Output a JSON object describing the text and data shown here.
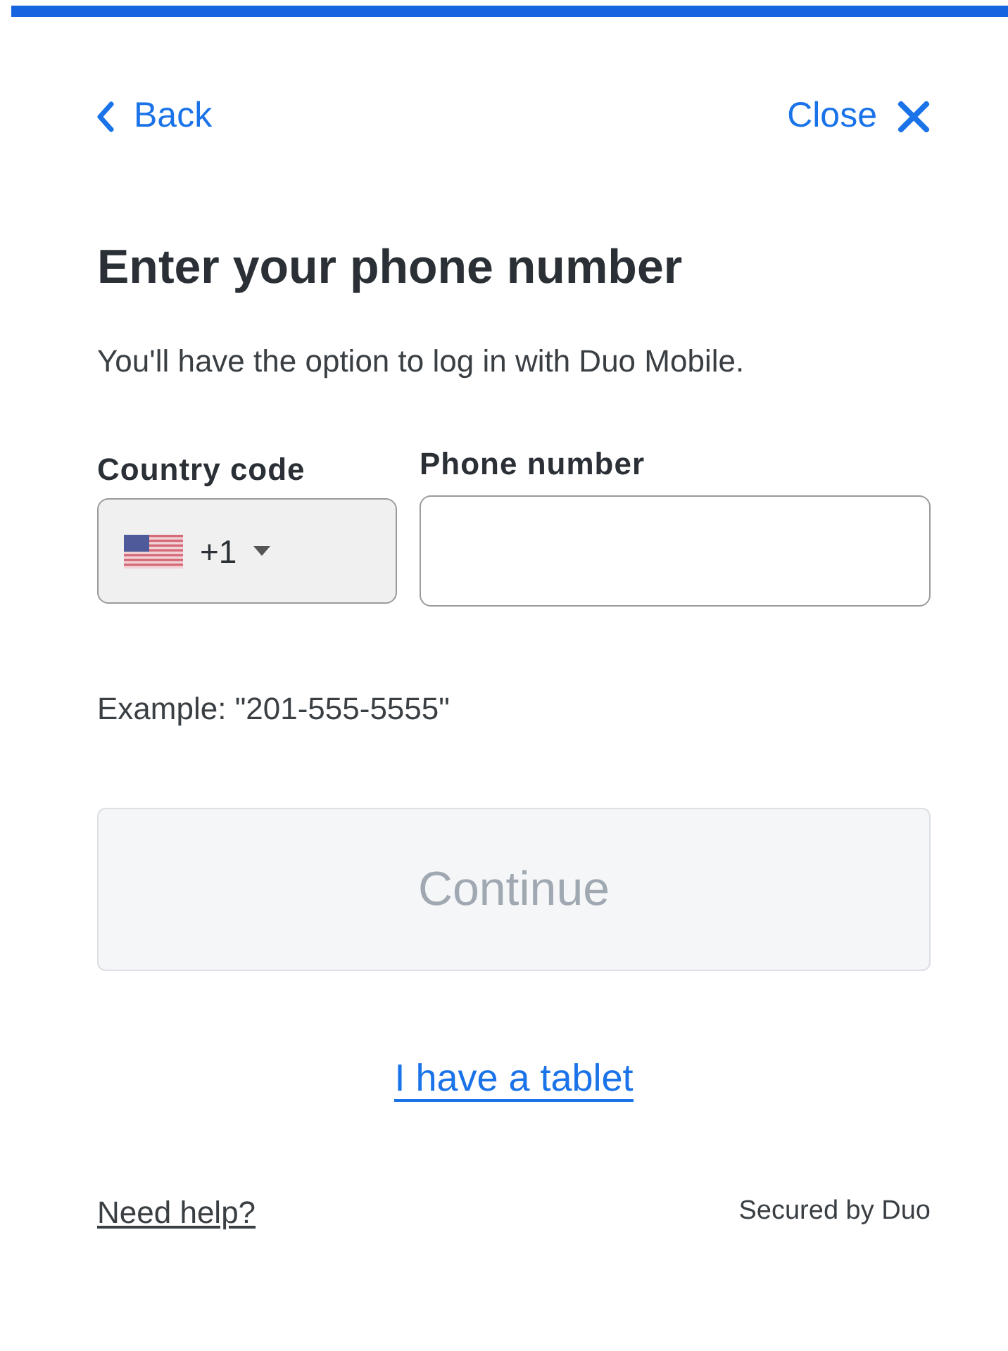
{
  "progress": {
    "level": 1
  },
  "nav": {
    "back": "Back",
    "close": "Close"
  },
  "title": "Enter your phone number",
  "subtitle": "You'll have the option to log in with Duo Mobile.",
  "country": {
    "label": "Country code",
    "code": "+1"
  },
  "phone": {
    "label": "Phone number"
  },
  "example": "Example: \"201-555-5555\"",
  "continue_button": {
    "label": "Continue",
    "disabled": true
  },
  "tablet_link": "I have a tablet",
  "footer": {
    "help": "Need help?",
    "secured": "Secured by Duo"
  }
}
